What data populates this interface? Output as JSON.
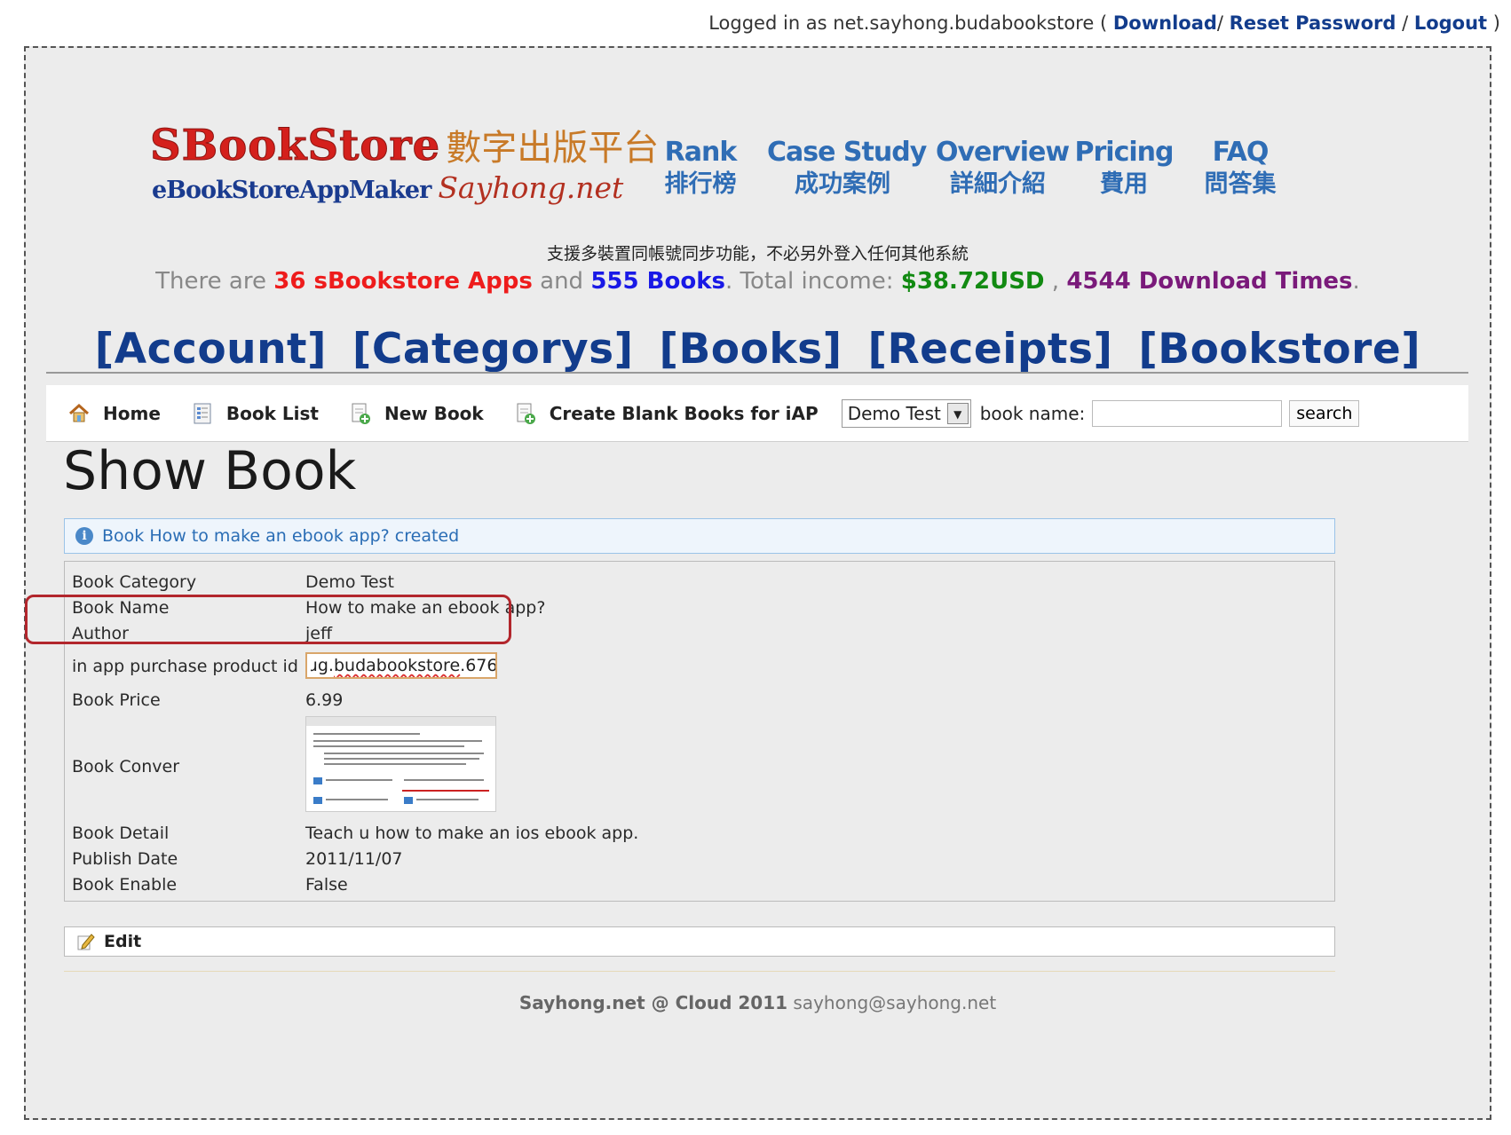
{
  "login": {
    "prefix": "Logged in as net.sayhong.budabookstore",
    "open_paren": "(",
    "download": "Download",
    "slash1": "/",
    "reset_password": "Reset Password",
    "slash2": "/",
    "logout": "Logout",
    "close_paren": ")"
  },
  "logo": {
    "title_en": "SBookStore",
    "title_zh": "數字出版平台",
    "subtitle_en": "eBookStoreAppMaker",
    "subtitle_net": "Sayhong.net"
  },
  "top_nav": [
    {
      "en": "Rank",
      "zh": "排行榜"
    },
    {
      "en": "Case Study",
      "zh": "成功案例"
    },
    {
      "en": "Overview",
      "zh": "詳細介紹"
    },
    {
      "en": "Pricing",
      "zh": "費用"
    },
    {
      "en": "FAQ",
      "zh": "問答集"
    }
  ],
  "promo": {
    "zh": "支援多裝置同帳號同步功能，不必另外登入任何其他系統",
    "there_are": "There are",
    "apps": "36 sBookstore Apps",
    "and": "and",
    "books": "555 Books",
    "total_income_label": ". Total income:",
    "income": "$38.72USD",
    "comma": ",",
    "downloads": "4544 Download Times",
    "period": "."
  },
  "big_menu": [
    "[Account]",
    "[Categorys]",
    "[Books]",
    "[Receipts]",
    "[Bookstore]"
  ],
  "toolbar": {
    "home": "Home",
    "book_list": "Book List",
    "new_book": "New Book",
    "create_blank": "Create Blank Books for iAP",
    "category_selected": "Demo Test",
    "book_name_label": "book name:",
    "book_name_value": "",
    "search_label": "search"
  },
  "page_title": "Show Book",
  "notice": "Book How to make an ebook app? created",
  "details": {
    "book_category": {
      "label": "Book Category",
      "value": "Demo Test"
    },
    "book_name": {
      "label": "Book Name",
      "value": "How to make an ebook app?"
    },
    "author": {
      "label": "Author",
      "value": "jeff"
    },
    "iap_id": {
      "label": "in app purchase product id",
      "value_prefix": "ɹg.",
      "value_squiggly": "budabookstore",
      "value_suffix": ".676"
    },
    "book_price": {
      "label": "Book Price",
      "value": "6.99"
    },
    "book_cover": {
      "label": "Book Conver"
    },
    "book_detail": {
      "label": "Book Detail",
      "value": "Teach u how to make an ios ebook app."
    },
    "publish_date": {
      "label": "Publish Date",
      "value": "2011/11/07"
    },
    "book_enable": {
      "label": "Book Enable",
      "value": "False"
    }
  },
  "edit_label": "Edit",
  "footer": {
    "brand": "Sayhong.net @ Cloud 2011",
    "email": "sayhong@sayhong.net"
  },
  "colors": {
    "link_blue": "#123c8c",
    "nav_blue": "#2f6db5",
    "highlight_red": "#b2262c",
    "apps_red": "#ee1c1c",
    "books_blue": "#1919e6",
    "income_green": "#128a12",
    "downloads_purple": "#7a1a7a"
  },
  "icons": [
    "home-icon",
    "book-list-icon",
    "new-book-icon",
    "create-blank-icon",
    "dropdown-arrow-icon",
    "info-icon",
    "edit-pencil-icon"
  ]
}
